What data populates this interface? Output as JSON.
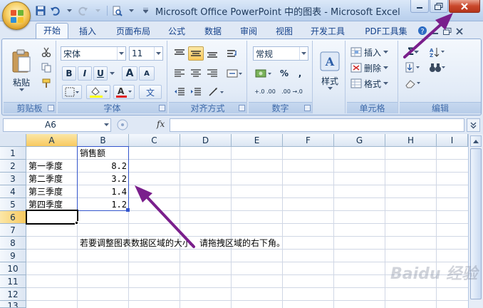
{
  "window": {
    "title": "Microsoft Office PowerPoint 中的图表 - Microsoft Excel",
    "controls": {
      "minimize": "minimize",
      "maximize": "maximize",
      "close": "close"
    }
  },
  "ribbon_tabs": [
    "开始",
    "插入",
    "页面布局",
    "公式",
    "数据",
    "审阅",
    "视图",
    "开发工具",
    "PDF工具集"
  ],
  "active_tab": "开始",
  "clipboard": {
    "label": "剪贴板",
    "paste": "粘贴"
  },
  "font": {
    "label": "字体",
    "name": "宋体",
    "size": "11",
    "bold": "B",
    "italic": "I",
    "underline": "U",
    "grow": "A",
    "shrink": "A",
    "phonetic": "文"
  },
  "alignment": {
    "label": "对齐方式"
  },
  "number": {
    "label": "数字",
    "format": "常规",
    "percent": "%",
    "comma": ",",
    "dec_inc": "+.0 .00",
    "dec_dec": ".00 →.0"
  },
  "styles": {
    "label": "样式"
  },
  "cells": {
    "label": "单元格",
    "insert": "插入",
    "delete": "删除",
    "format": "格式"
  },
  "editing": {
    "label": "编辑",
    "sum": "Σ"
  },
  "formula_bar": {
    "name_box": "A6",
    "fx": "fx",
    "value": ""
  },
  "columns": [
    "A",
    "B",
    "C",
    "D",
    "E",
    "F",
    "G",
    "H",
    "I"
  ],
  "rows": [
    "1",
    "2",
    "3",
    "4",
    "5",
    "6",
    "7",
    "8",
    "9",
    "10",
    "11",
    "12",
    "13"
  ],
  "sheet": {
    "b1": "销售额",
    "a2": "第一季度",
    "b2": "8.2",
    "a3": "第二季度",
    "b3": "3.2",
    "a4": "第三季度",
    "b4": "1.4",
    "a5": "第四季度",
    "b5": "1.2",
    "b8": "若要调整图表数据区域的大小，请拖拽区域的右下角。"
  },
  "watermark": "Baidu 经验",
  "colors": {
    "accent": "#15428b",
    "range": "#3355cc",
    "arrow": "#7a1f8c"
  }
}
